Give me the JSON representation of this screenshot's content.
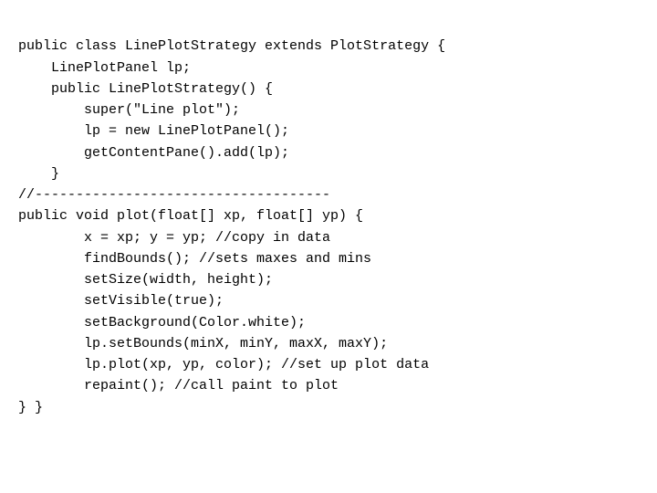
{
  "code": {
    "lines": [
      {
        "id": "line1",
        "indent": 0,
        "text": "public class LinePlotStrategy extends PlotStrategy {"
      },
      {
        "id": "line2",
        "indent": 1,
        "text": "LinePlotPanel lp;"
      },
      {
        "id": "line3",
        "indent": 1,
        "text": "public LinePlotStrategy() {"
      },
      {
        "id": "line4",
        "indent": 2,
        "text": "super(\"Line plot\");"
      },
      {
        "id": "line5",
        "indent": 2,
        "text": "lp = new LinePlotPanel();"
      },
      {
        "id": "line6",
        "indent": 2,
        "text": "getContentPane().add(lp);"
      },
      {
        "id": "line7",
        "indent": 1,
        "text": "}"
      },
      {
        "id": "line8",
        "indent": 0,
        "text": "//------------------------------------"
      },
      {
        "id": "line9",
        "indent": 0,
        "text": "public void plot(float[] xp, float[] yp) {"
      },
      {
        "id": "line10",
        "indent": 2,
        "text": "x = xp; y = yp; //copy in data"
      },
      {
        "id": "line11",
        "indent": 2,
        "text": "findBounds(); //sets maxes and mins"
      },
      {
        "id": "line12",
        "indent": 2,
        "text": "setSize(width, height);"
      },
      {
        "id": "line13",
        "indent": 2,
        "text": "setVisible(true);"
      },
      {
        "id": "line14",
        "indent": 2,
        "text": "setBackground(Color.white);"
      },
      {
        "id": "line15",
        "indent": 2,
        "text": "lp.setBounds(minX, minY, maxX, maxY);"
      },
      {
        "id": "line16",
        "indent": 2,
        "text": "lp.plot(xp, yp, color); //set up plot data"
      },
      {
        "id": "line17",
        "indent": 2,
        "text": "repaint(); //call paint to plot"
      },
      {
        "id": "line18",
        "indent": 0,
        "text": "} }"
      }
    ]
  }
}
